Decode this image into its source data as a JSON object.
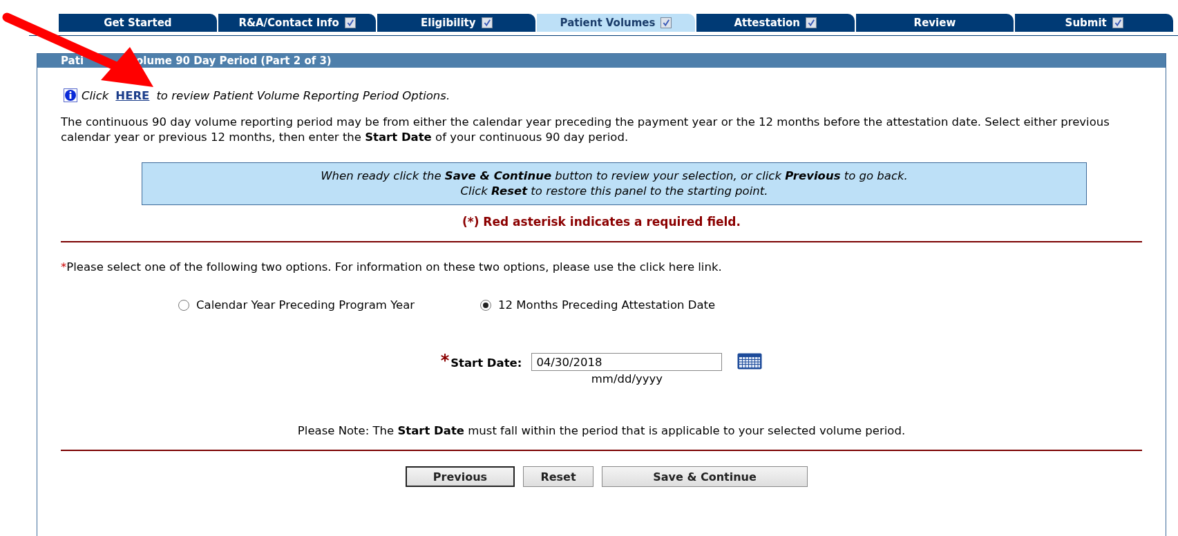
{
  "tabs": [
    {
      "label": "Get Started",
      "kind": "plain",
      "selected": false
    },
    {
      "label": "R&A/Contact Info",
      "kind": "check",
      "checked": true,
      "selected": false
    },
    {
      "label": "Eligibility",
      "kind": "check",
      "checked": true,
      "selected": false
    },
    {
      "label": "Patient Volumes",
      "kind": "check",
      "checked": true,
      "selected": true
    },
    {
      "label": "Attestation",
      "kind": "check",
      "checked": true,
      "selected": false
    },
    {
      "label": "Review",
      "kind": "plain",
      "selected": false
    },
    {
      "label": "Submit",
      "kind": "check",
      "checked": true,
      "selected": false
    }
  ],
  "panel": {
    "title_parts": [
      "Pati",
      "olume 90 Day Period (Part 2 of 3)"
    ],
    "info": {
      "before": "Click",
      "link": "HERE",
      "after": "to review Patient Volume Reporting Period Options."
    },
    "intro": "The continuous 90 day volume reporting period may be from either the calendar year preceding the payment year or the 12 months before the attestation date. Select either previous calendar year or previous 12 months, then enter the **Start Date** of your continuous 90 day period.",
    "instructions": [
      "When ready click the **Save & Continue** button to review your selection, or click **Previous** to go back.",
      "Click **Reset** to restore this panel to the starting point."
    ],
    "required_note": "(*) Red asterisk indicates a required field.",
    "question": {
      "asterisk": "*",
      "text": "Please select one of the following two options. For information on these two options, please use the click here link."
    },
    "options": [
      {
        "label": "Calendar Year Preceding Program Year",
        "selected": false
      },
      {
        "label": "12 Months Preceding Attestation Date",
        "selected": true
      }
    ],
    "start_date": {
      "asterisk": "*",
      "label": "Start Date:",
      "value": "04/30/2018",
      "hint": "mm/dd/yyyy"
    },
    "note": "Please Note: The **Start Date** must fall within the period that is applicable to your selected volume period.",
    "buttons": [
      {
        "label": "Previous",
        "selected": true
      },
      {
        "label": "Reset",
        "selected": false
      },
      {
        "label": "Save & Continue",
        "selected": false
      }
    ]
  }
}
